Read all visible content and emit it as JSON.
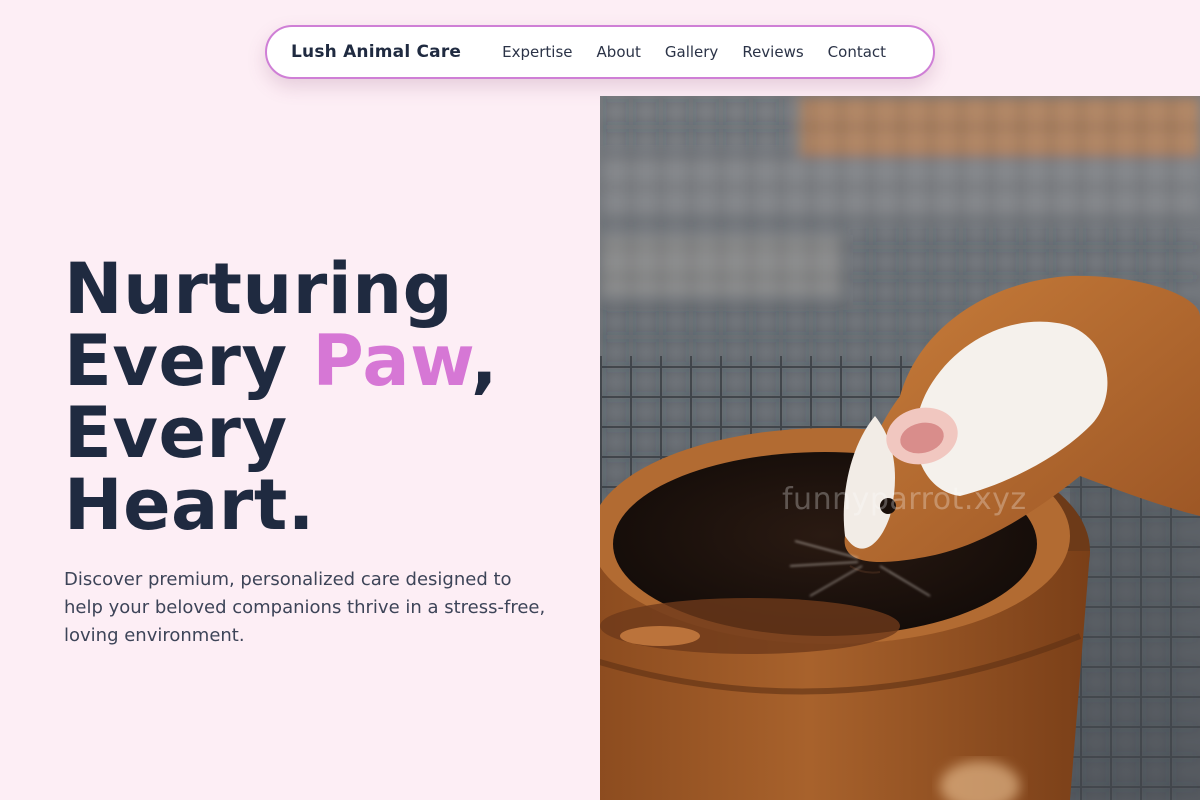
{
  "nav": {
    "brand": "Lush Animal Care",
    "links": [
      "Expertise",
      "About",
      "Gallery",
      "Reviews",
      "Contact"
    ]
  },
  "hero": {
    "title_line1": "Nurturing",
    "title_line2_pre": "Every ",
    "title_line2_accent": "Paw",
    "title_line2_post": ",",
    "title_line3": "Every",
    "title_line4": "Heart.",
    "subtitle": "Discover premium, personalized care designed to help your beloved companions thrive in a stress-free, loving environment.",
    "image_watermark": "funnyparrot.xyz"
  },
  "colors": {
    "background": "#fdeef5",
    "accent": "#d677d5",
    "heading": "#1f2a40",
    "nav_border": "#cf7fd6"
  },
  "image": {
    "subject": "guinea-pig-drinking-from-clay-bowl"
  }
}
